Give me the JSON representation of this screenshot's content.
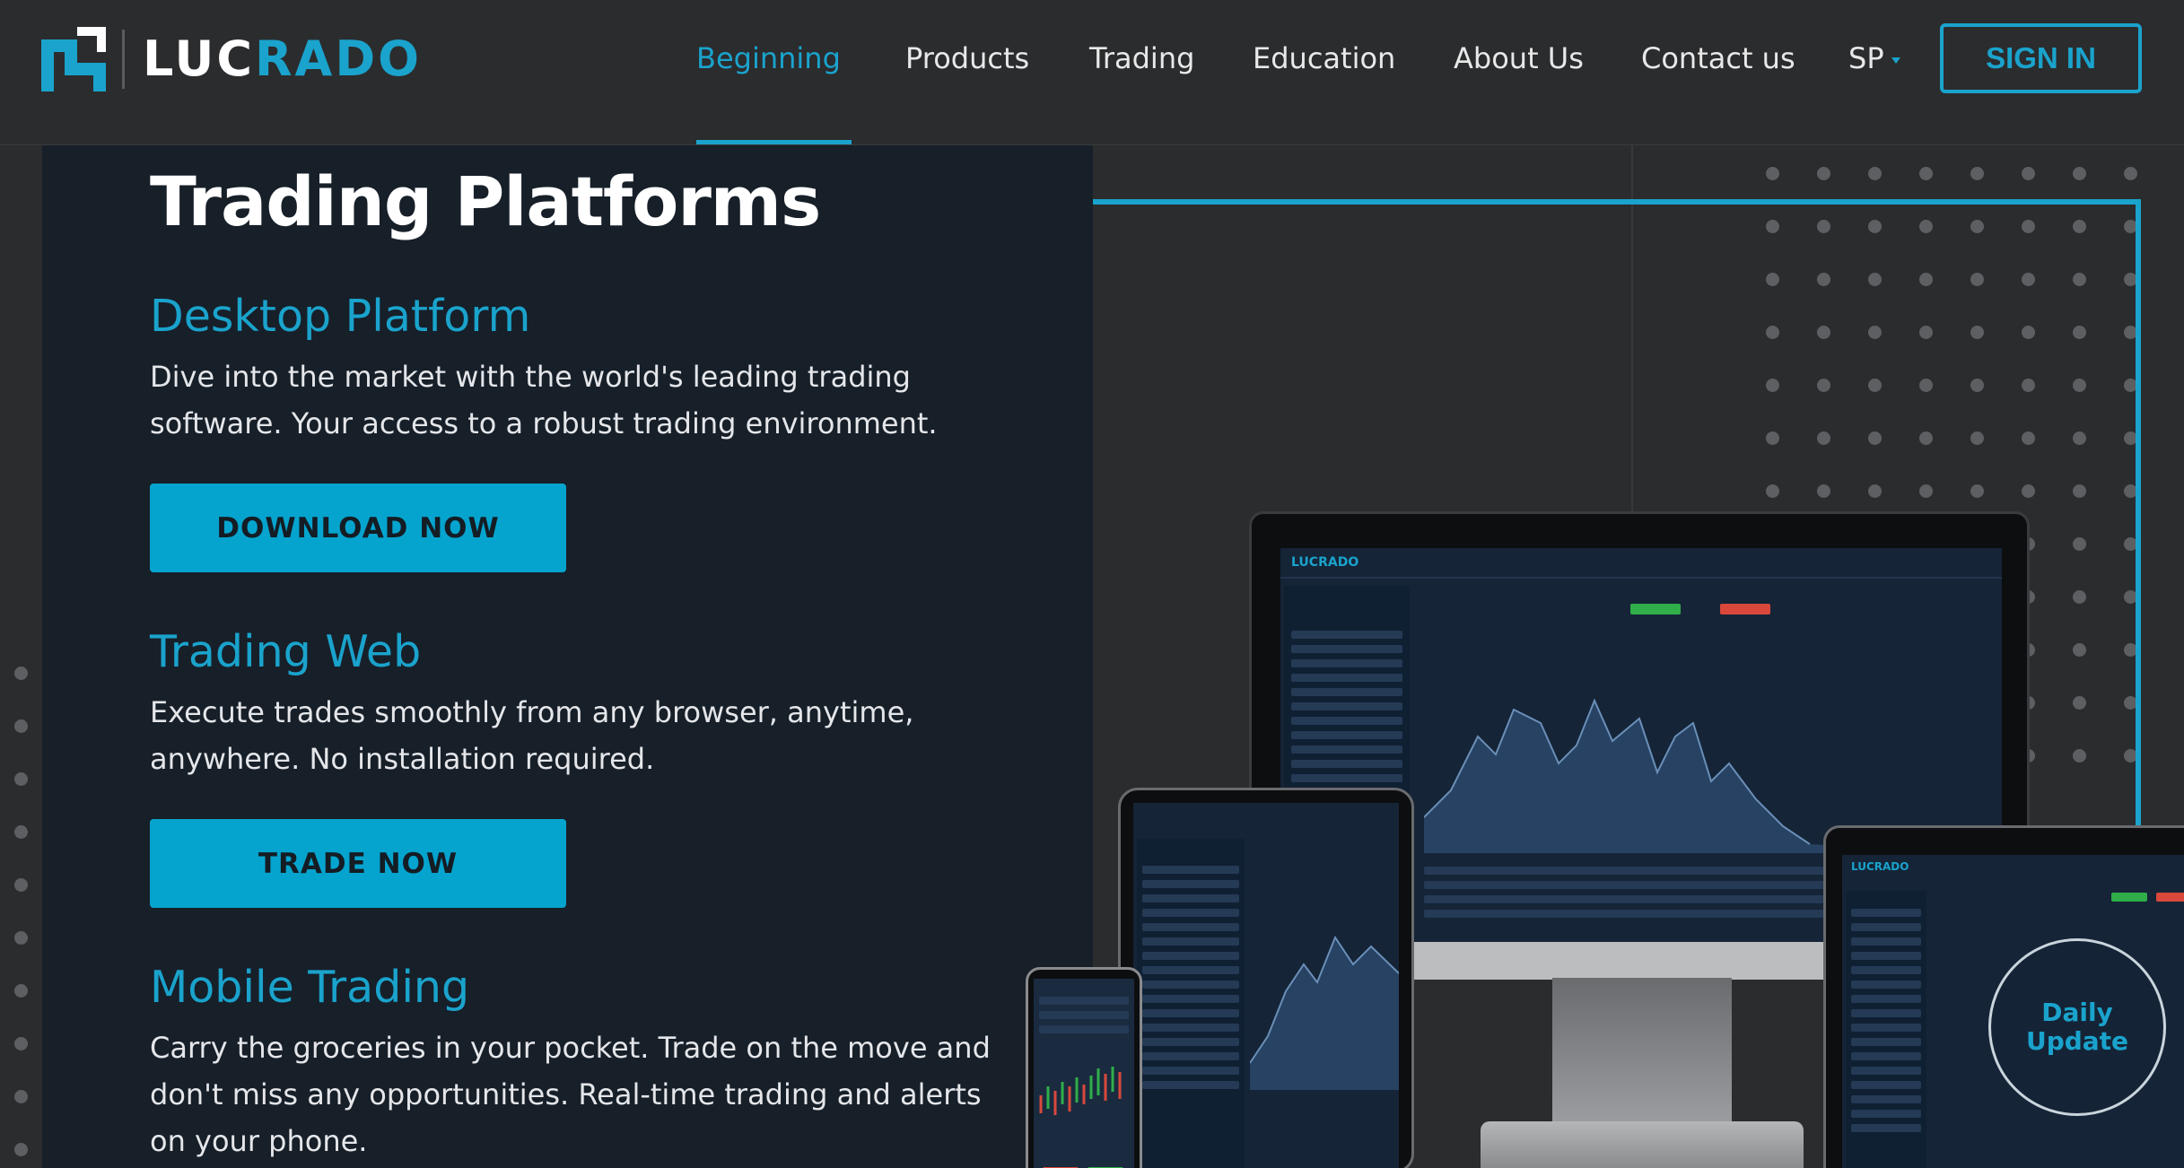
{
  "header": {
    "logo": {
      "part1": "LUC",
      "part2": "RADO"
    },
    "nav": [
      {
        "label": "Beginning",
        "active": true
      },
      {
        "label": "Products"
      },
      {
        "label": "Trading"
      },
      {
        "label": "Education"
      },
      {
        "label": "About Us"
      },
      {
        "label": "Contact us"
      },
      {
        "label": "SP"
      }
    ],
    "sign_in_label": "SIGN IN"
  },
  "main": {
    "title": "Trading Platforms",
    "sections": [
      {
        "title": "Desktop Platform",
        "desc": "Dive into the market with the world's leading trading software. Your access to a robust trading environment.",
        "button": "DOWNLOAD NOW"
      },
      {
        "title": "Trading Web",
        "desc": "Execute trades smoothly from any browser, anytime, anywhere. No installation required.",
        "button": "TRADE NOW"
      },
      {
        "title": "Mobile Trading",
        "desc": "Carry the groceries in your pocket. Trade on the move and don't miss any opportunities. Real-time trading and alerts on your phone."
      }
    ]
  },
  "hero": {
    "screen_logo": {
      "part1": "LUC",
      "part2": "RADO"
    },
    "daily_update": "Daily Update"
  },
  "colors": {
    "accent": "#1aa3cc",
    "button_bg": "#05a4ce",
    "panel_bg": "#171f29",
    "page_bg": "#2b2c2e"
  }
}
